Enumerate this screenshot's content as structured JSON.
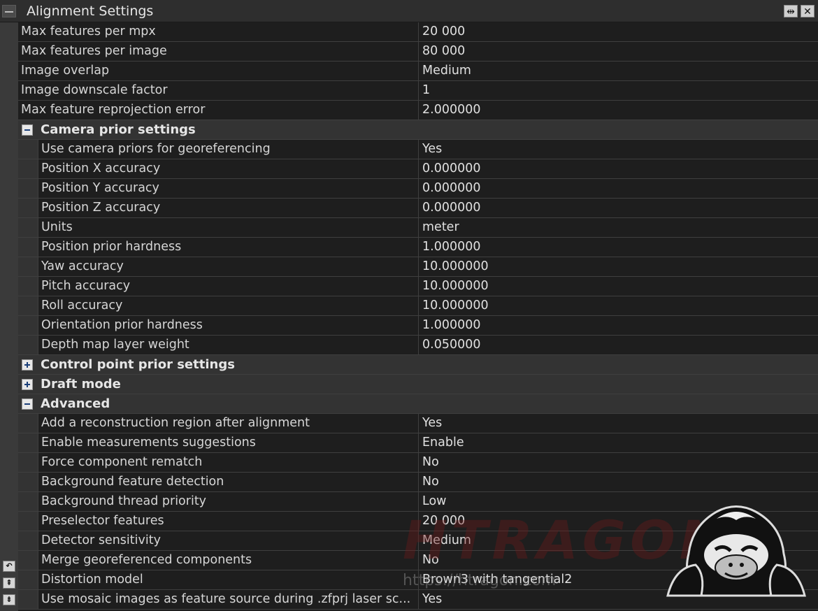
{
  "panel": {
    "title": "Alignment Settings"
  },
  "rows_top": [
    {
      "name": "Max features per mpx",
      "value": "20 000"
    },
    {
      "name": "Max features per image",
      "value": "80 000"
    },
    {
      "name": "Image overlap",
      "value": "Medium"
    },
    {
      "name": "Image downscale factor",
      "value": "1"
    },
    {
      "name": "Max feature reprojection error",
      "value": "2.000000"
    }
  ],
  "sections": {
    "camera_prior": {
      "label": "Camera prior settings",
      "expanded": true,
      "rows": [
        {
          "name": "Use camera priors for georeferencing",
          "value": "Yes"
        },
        {
          "name": "Position X accuracy",
          "value": "0.000000"
        },
        {
          "name": "Position Y accuracy",
          "value": "0.000000"
        },
        {
          "name": "Position Z accuracy",
          "value": "0.000000"
        },
        {
          "name": "Units",
          "value": "meter"
        },
        {
          "name": "Position prior hardness",
          "value": "1.000000"
        },
        {
          "name": "Yaw accuracy",
          "value": "10.000000"
        },
        {
          "name": "Pitch accuracy",
          "value": "10.000000"
        },
        {
          "name": "Roll accuracy",
          "value": "10.000000"
        },
        {
          "name": "Orientation prior hardness",
          "value": "1.000000"
        },
        {
          "name": "Depth map layer weight",
          "value": "0.050000"
        }
      ]
    },
    "control_point_prior": {
      "label": "Control point prior settings",
      "expanded": false
    },
    "draft_mode": {
      "label": "Draft mode",
      "expanded": false
    },
    "advanced": {
      "label": "Advanced",
      "expanded": true,
      "rows": [
        {
          "name": "Add a reconstruction region after alignment",
          "value": "Yes"
        },
        {
          "name": "Enable measurements suggestions",
          "value": "Enable"
        },
        {
          "name": "Force component rematch",
          "value": "No"
        },
        {
          "name": "Background feature detection",
          "value": "No"
        },
        {
          "name": "Background thread priority",
          "value": "Low"
        },
        {
          "name": "Preselector features",
          "value": "20 000"
        },
        {
          "name": "Detector sensitivity",
          "value": "Medium"
        },
        {
          "name": "Merge georeferenced components",
          "value": "No"
        },
        {
          "name": "Distortion model",
          "value": "Brown3 with tangential2"
        },
        {
          "name": "Use mosaic images as feature source during .zfprj laser sc...",
          "value": "Yes"
        }
      ]
    }
  },
  "watermark": {
    "text": "HTRAGON",
    "url": "https://htragon.com"
  },
  "icons": {
    "collapse_panel": "minus-icon",
    "float": "float-window-icon",
    "close": "close-icon",
    "expanded_section": "minus-square-icon",
    "collapsed_section": "plus-square-icon",
    "nav_left": "undo-icon",
    "nav_up": "move-up-icon",
    "nav_down": "move-down-icon"
  }
}
